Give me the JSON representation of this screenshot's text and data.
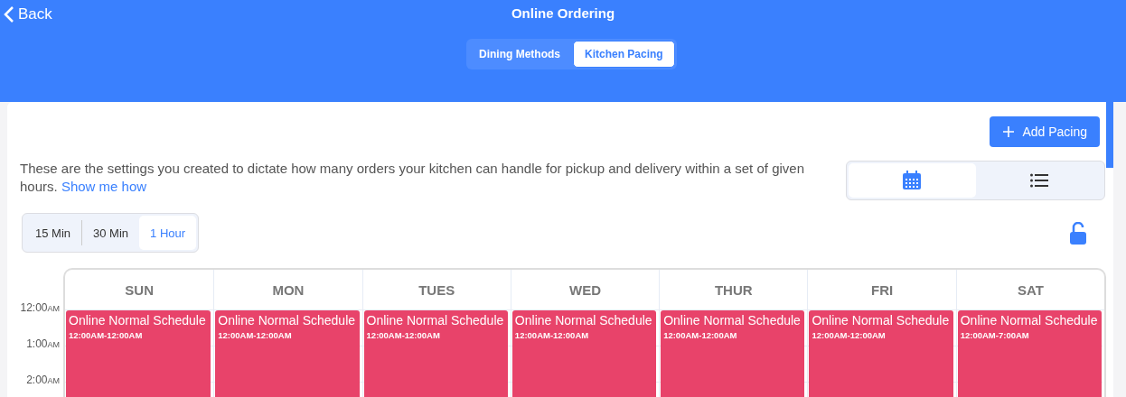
{
  "header": {
    "back": "Back",
    "title": "Online Ordering"
  },
  "tabs": [
    {
      "label": "Dining Methods",
      "selected": false
    },
    {
      "label": "Kitchen Pacing",
      "selected": true
    }
  ],
  "add_button": "Add Pacing",
  "description": {
    "text": "These are the settings you created to dictate how many orders your kitchen can handle for pickup and delivery within a set of given hours.",
    "link": "Show me how"
  },
  "view_toggle": [
    {
      "kind": "calendar",
      "selected": true
    },
    {
      "kind": "list",
      "selected": false
    }
  ],
  "intervals": [
    {
      "label": "15 Min",
      "selected": false
    },
    {
      "label": "30 Min",
      "selected": false
    },
    {
      "label": "1 Hour",
      "selected": true
    }
  ],
  "lock": {
    "locked": false
  },
  "calendar": {
    "days": [
      "SUN",
      "MON",
      "TUES",
      "WED",
      "THUR",
      "FRI",
      "SAT"
    ],
    "times": [
      {
        "time": "12:00",
        "meridiem": "AM"
      },
      {
        "time": "1:00",
        "meridiem": "AM"
      },
      {
        "time": "2:00",
        "meridiem": "AM"
      }
    ],
    "events": [
      {
        "title": "Online Normal Schedule",
        "range": "12:00AM-12:00AM"
      },
      {
        "title": "Online Normal Schedule",
        "range": "12:00AM-12:00AM"
      },
      {
        "title": "Online Normal Schedule",
        "range": "12:00AM-12:00AM"
      },
      {
        "title": "Online Normal Schedule",
        "range": "12:00AM-12:00AM"
      },
      {
        "title": "Online Normal Schedule",
        "range": "12:00AM-12:00AM"
      },
      {
        "title": "Online Normal Schedule",
        "range": "12:00AM-12:00AM"
      },
      {
        "title": "Online Normal Schedule",
        "range": "12:00AM-7:00AM"
      }
    ]
  }
}
